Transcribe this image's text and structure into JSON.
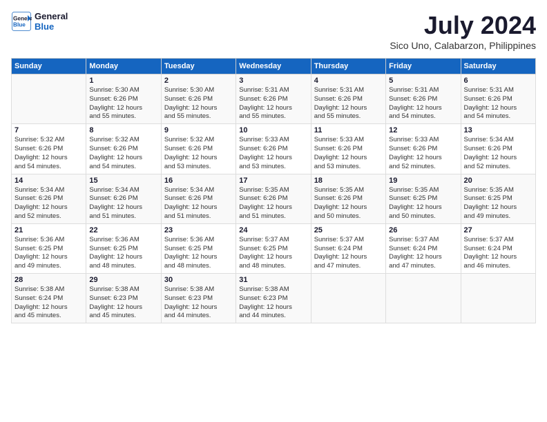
{
  "header": {
    "logo_line1": "General",
    "logo_line2": "Blue",
    "title": "July 2024",
    "subtitle": "Sico Uno, Calabarzon, Philippines"
  },
  "calendar": {
    "days_of_week": [
      "Sunday",
      "Monday",
      "Tuesday",
      "Wednesday",
      "Thursday",
      "Friday",
      "Saturday"
    ],
    "weeks": [
      [
        {
          "day": "",
          "content": ""
        },
        {
          "day": "1",
          "content": "Sunrise: 5:30 AM\nSunset: 6:26 PM\nDaylight: 12 hours\nand 55 minutes."
        },
        {
          "day": "2",
          "content": "Sunrise: 5:30 AM\nSunset: 6:26 PM\nDaylight: 12 hours\nand 55 minutes."
        },
        {
          "day": "3",
          "content": "Sunrise: 5:31 AM\nSunset: 6:26 PM\nDaylight: 12 hours\nand 55 minutes."
        },
        {
          "day": "4",
          "content": "Sunrise: 5:31 AM\nSunset: 6:26 PM\nDaylight: 12 hours\nand 55 minutes."
        },
        {
          "day": "5",
          "content": "Sunrise: 5:31 AM\nSunset: 6:26 PM\nDaylight: 12 hours\nand 54 minutes."
        },
        {
          "day": "6",
          "content": "Sunrise: 5:31 AM\nSunset: 6:26 PM\nDaylight: 12 hours\nand 54 minutes."
        }
      ],
      [
        {
          "day": "7",
          "content": "Sunrise: 5:32 AM\nSunset: 6:26 PM\nDaylight: 12 hours\nand 54 minutes."
        },
        {
          "day": "8",
          "content": "Sunrise: 5:32 AM\nSunset: 6:26 PM\nDaylight: 12 hours\nand 54 minutes."
        },
        {
          "day": "9",
          "content": "Sunrise: 5:32 AM\nSunset: 6:26 PM\nDaylight: 12 hours\nand 53 minutes."
        },
        {
          "day": "10",
          "content": "Sunrise: 5:33 AM\nSunset: 6:26 PM\nDaylight: 12 hours\nand 53 minutes."
        },
        {
          "day": "11",
          "content": "Sunrise: 5:33 AM\nSunset: 6:26 PM\nDaylight: 12 hours\nand 53 minutes."
        },
        {
          "day": "12",
          "content": "Sunrise: 5:33 AM\nSunset: 6:26 PM\nDaylight: 12 hours\nand 52 minutes."
        },
        {
          "day": "13",
          "content": "Sunrise: 5:34 AM\nSunset: 6:26 PM\nDaylight: 12 hours\nand 52 minutes."
        }
      ],
      [
        {
          "day": "14",
          "content": "Sunrise: 5:34 AM\nSunset: 6:26 PM\nDaylight: 12 hours\nand 52 minutes."
        },
        {
          "day": "15",
          "content": "Sunrise: 5:34 AM\nSunset: 6:26 PM\nDaylight: 12 hours\nand 51 minutes."
        },
        {
          "day": "16",
          "content": "Sunrise: 5:34 AM\nSunset: 6:26 PM\nDaylight: 12 hours\nand 51 minutes."
        },
        {
          "day": "17",
          "content": "Sunrise: 5:35 AM\nSunset: 6:26 PM\nDaylight: 12 hours\nand 51 minutes."
        },
        {
          "day": "18",
          "content": "Sunrise: 5:35 AM\nSunset: 6:26 PM\nDaylight: 12 hours\nand 50 minutes."
        },
        {
          "day": "19",
          "content": "Sunrise: 5:35 AM\nSunset: 6:25 PM\nDaylight: 12 hours\nand 50 minutes."
        },
        {
          "day": "20",
          "content": "Sunrise: 5:35 AM\nSunset: 6:25 PM\nDaylight: 12 hours\nand 49 minutes."
        }
      ],
      [
        {
          "day": "21",
          "content": "Sunrise: 5:36 AM\nSunset: 6:25 PM\nDaylight: 12 hours\nand 49 minutes."
        },
        {
          "day": "22",
          "content": "Sunrise: 5:36 AM\nSunset: 6:25 PM\nDaylight: 12 hours\nand 48 minutes."
        },
        {
          "day": "23",
          "content": "Sunrise: 5:36 AM\nSunset: 6:25 PM\nDaylight: 12 hours\nand 48 minutes."
        },
        {
          "day": "24",
          "content": "Sunrise: 5:37 AM\nSunset: 6:25 PM\nDaylight: 12 hours\nand 48 minutes."
        },
        {
          "day": "25",
          "content": "Sunrise: 5:37 AM\nSunset: 6:24 PM\nDaylight: 12 hours\nand 47 minutes."
        },
        {
          "day": "26",
          "content": "Sunrise: 5:37 AM\nSunset: 6:24 PM\nDaylight: 12 hours\nand 47 minutes."
        },
        {
          "day": "27",
          "content": "Sunrise: 5:37 AM\nSunset: 6:24 PM\nDaylight: 12 hours\nand 46 minutes."
        }
      ],
      [
        {
          "day": "28",
          "content": "Sunrise: 5:38 AM\nSunset: 6:24 PM\nDaylight: 12 hours\nand 45 minutes."
        },
        {
          "day": "29",
          "content": "Sunrise: 5:38 AM\nSunset: 6:23 PM\nDaylight: 12 hours\nand 45 minutes."
        },
        {
          "day": "30",
          "content": "Sunrise: 5:38 AM\nSunset: 6:23 PM\nDaylight: 12 hours\nand 44 minutes."
        },
        {
          "day": "31",
          "content": "Sunrise: 5:38 AM\nSunset: 6:23 PM\nDaylight: 12 hours\nand 44 minutes."
        },
        {
          "day": "",
          "content": ""
        },
        {
          "day": "",
          "content": ""
        },
        {
          "day": "",
          "content": ""
        }
      ]
    ]
  }
}
